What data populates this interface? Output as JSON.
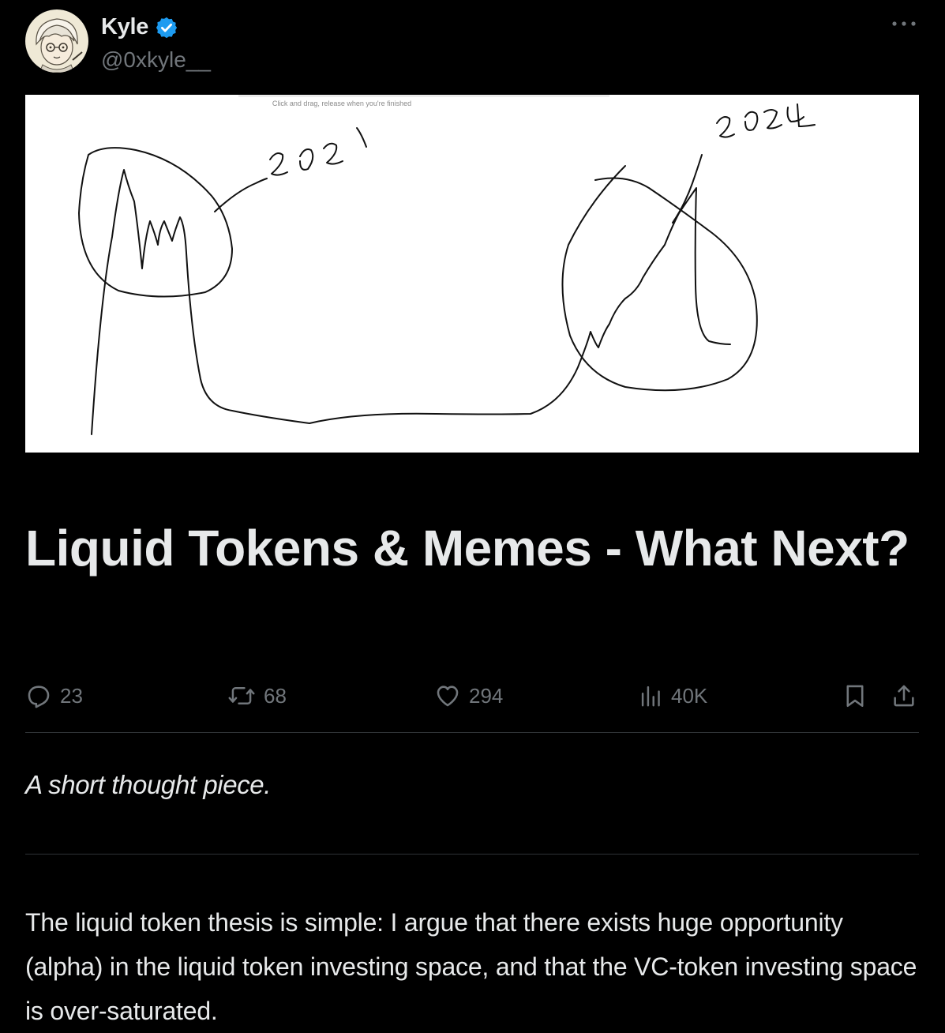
{
  "author": {
    "name": "Kyle",
    "handle": "@0xkyle__",
    "verified": true,
    "verified_color": "#1d9bf0"
  },
  "menu": {
    "icon": "more-horizontal-icon"
  },
  "cover_image": {
    "hint_text": "Click and drag, release when you're finished",
    "annotations": [
      "2021",
      "2024"
    ]
  },
  "article": {
    "title": "Liquid Tokens & Memes - What Next?",
    "subtitle": "A short thought piece.",
    "body": "The liquid token thesis is simple: I argue that there exists huge opportunity (alpha) in the liquid token investing space, and that the VC-token investing space is over-saturated."
  },
  "actions": {
    "replies": {
      "icon": "reply-icon",
      "count": "23"
    },
    "reposts": {
      "icon": "repost-icon",
      "count": "68"
    },
    "likes": {
      "icon": "heart-icon",
      "count": "294"
    },
    "views": {
      "icon": "views-icon",
      "count": "40K"
    },
    "bookmark": {
      "icon": "bookmark-icon"
    },
    "share": {
      "icon": "share-icon"
    }
  },
  "colors": {
    "background": "#000000",
    "text_primary": "#e7e9ea",
    "text_secondary": "#71767b",
    "divider": "#2f3336",
    "accent": "#1d9bf0"
  }
}
